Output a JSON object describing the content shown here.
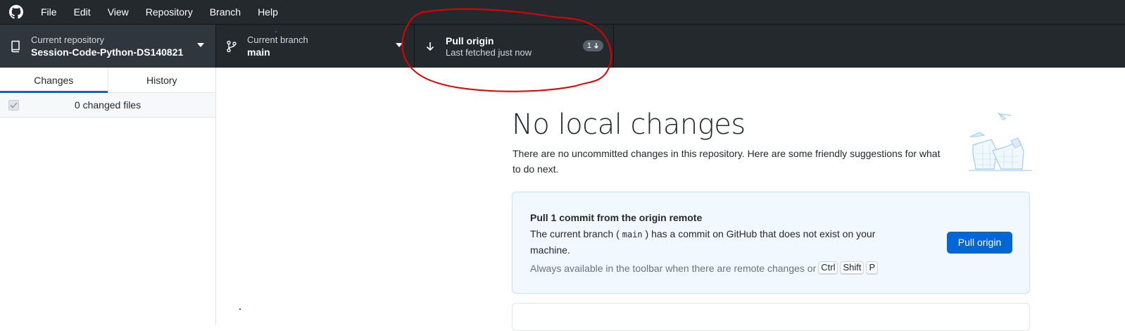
{
  "menubar": {
    "items": [
      "File",
      "Edit",
      "View",
      "Repository",
      "Branch",
      "Help"
    ]
  },
  "toolbar": {
    "repo_label": "Current repository",
    "repo_value": "Session-Code-Python-DS140821",
    "branch_label": "Current branch",
    "branch_value": "main",
    "pull_title": "Pull origin",
    "pull_subtitle": "Last fetched just now",
    "pull_badge_count": "1",
    "pull_badge_icon": "arrow-down-icon"
  },
  "sidebar": {
    "tabs": [
      "Changes",
      "History"
    ],
    "active_tab": "Changes",
    "changes_count": "0 changed files"
  },
  "main": {
    "title": "No local changes",
    "description": "There are no uncommitted changes in this repository. Here are some friendly suggestions for what to do next.",
    "card": {
      "title": "Pull 1 commit from the origin remote",
      "desc_before": "The current branch (",
      "desc_branch": "main",
      "desc_after": ") has a commit on GitHub that does not exist on your machine.",
      "hint": "Always available in the toolbar when there are remote changes or",
      "shortcut_keys": [
        "Ctrl",
        "Shift",
        "P"
      ],
      "button_label": "Pull origin"
    }
  },
  "colors": {
    "toolbar_bg": "#24292e",
    "accent": "#0366d6",
    "annotation": "#e00000",
    "card_bg": "#f1f8ff"
  }
}
